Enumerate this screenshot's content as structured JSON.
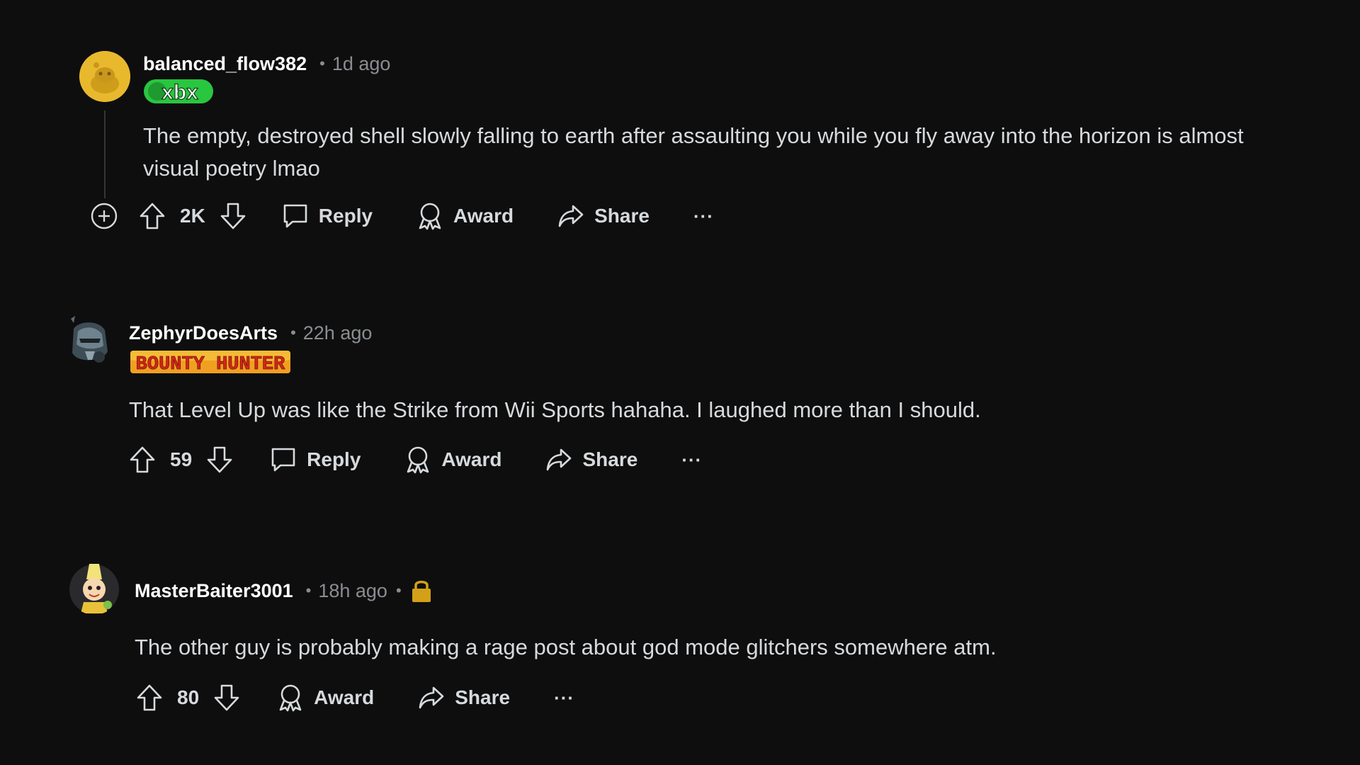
{
  "comments": [
    {
      "username": "balanced_flow382",
      "time": "1d ago",
      "flair": "xbx",
      "flair_color": "#29c63f",
      "body": "The empty, destroyed shell slowly falling to earth after assaulting you while you fly away into the horizon is almost visual poetry lmao",
      "votes": "2K",
      "reply_label": "Reply",
      "award_label": "Award",
      "share_label": "Share",
      "more_label": "···",
      "avatar_color": "#e8b92d"
    },
    {
      "username": "ZephyrDoesArts",
      "time": "22h ago",
      "flair": "BOUNTY HUNTER",
      "flair_color": "#f0a020",
      "body": "That Level Up was like the Strike from Wii Sports hahaha. I laughed more than I should.",
      "votes": "59",
      "reply_label": "Reply",
      "award_label": "Award",
      "share_label": "Share",
      "more_label": "···"
    },
    {
      "username": "MasterBaiter3001",
      "time": "18h ago",
      "body": "The other guy is probably making a rage post about god mode glitchers somewhere atm.",
      "votes": "80",
      "award_label": "Award",
      "share_label": "Share",
      "more_label": "···",
      "lock_color": "#d4a017"
    }
  ],
  "colors": {
    "background": "#0e0e0f",
    "text": "#d7dadc",
    "muted": "#8a8d90"
  }
}
